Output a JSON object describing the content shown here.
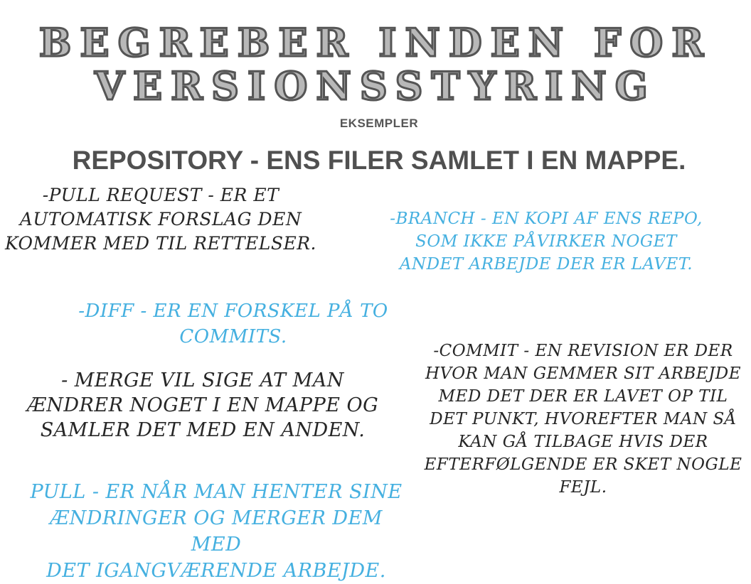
{
  "title": {
    "line1": "BEGREBER INDEN FOR",
    "line2": "VERSIONSSTYRING"
  },
  "subtitle": "EKSEMPLER",
  "repository": "REPOSITORY - ENS FILER SAMLET I EN MAPPE.",
  "notes": {
    "pull_request": "-PULL REQUEST - ER ET\nAUTOMATISK FORSLAG DEN\nKOMMER MED TIL RETTELSER.",
    "branch": "-BRANCH - EN KOPI AF ENS REPO,\nSOM IKKE PÅVIRKER NOGET\nANDET ARBEJDE DER ER LAVET.",
    "diff": "-DIFF - ER EN FORSKEL PÅ TO\nCOMMITS.",
    "commit": "-COMMIT - EN REVISION ER DER\nHVOR MAN GEMMER SIT ARBEJDE\nMED DET DER ER LAVET OP TIL\nDET PUNKT, HVOREFTER MAN SÅ\nKAN GÅ TILBAGE HVIS DER\nEFTERFØLGENDE ER SKET NOGLE\nFEJL.",
    "merge": "- MERGE VIL SIGE AT MAN\nÆNDRER NOGET I EN MAPPE OG\nSAMLER DET MED EN ANDEN.",
    "pull": "PULL - ER NÅR MAN HENTER SINE\nÆNDRINGER OG MERGER DEM MED\nDET IGANGVÆRENDE ARBEJDE."
  },
  "colors": {
    "title_fill": "#b8b8b8",
    "title_outline": "#555555",
    "dark_text": "#262626",
    "blue_text": "#45b0e0"
  }
}
